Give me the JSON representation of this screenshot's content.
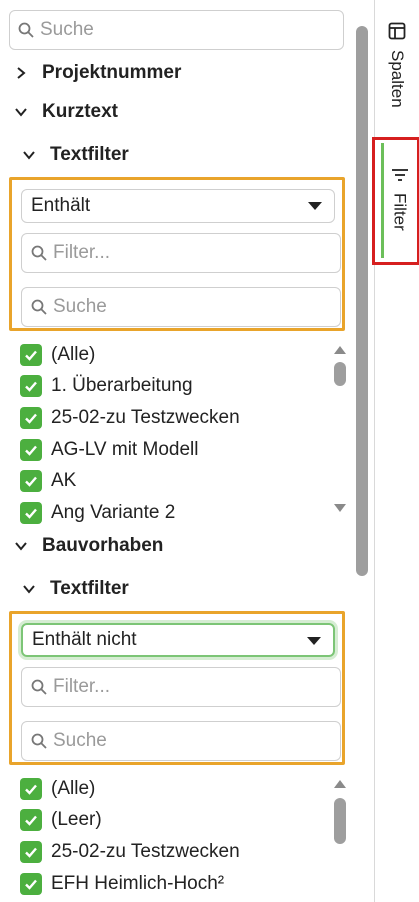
{
  "search": {
    "placeholder": "Suche"
  },
  "groups": {
    "projektnummer": "Projektnummer",
    "kurztext": "Kurztext",
    "bauvorhaben": "Bauvorhaben"
  },
  "kurztext_filter": {
    "header": "Textfilter",
    "operator": "Enthält",
    "filter_placeholder": "Filter...",
    "search_placeholder": "Suche",
    "values": [
      "(Alle)",
      "1. Überarbeitung",
      "25-02-zu Testzwecken",
      "AG-LV mit Modell",
      "AK",
      "Ang Variante 2"
    ]
  },
  "bauvorhaben_filter": {
    "header": "Textfilter",
    "operator": "Enthält nicht",
    "filter_placeholder": "Filter...",
    "search_placeholder": "Suche",
    "values": [
      "(Alle)",
      "(Leer)",
      "25-02-zu Testzwecken",
      "EFH Heimlich-Hoch²"
    ]
  },
  "side_tabs": {
    "columns": "Spalten",
    "filter": "Filter"
  },
  "colors": {
    "accent_orange": "#e9a42b",
    "checkbox_green": "#4caf3f",
    "highlight_red": "#d61f1f"
  }
}
